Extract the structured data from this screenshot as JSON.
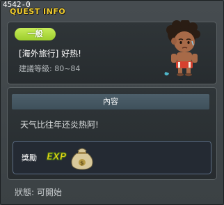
{
  "window": {
    "quest_id": "4542-0",
    "title": "QUEST INFO"
  },
  "quest": {
    "category": "一般",
    "name": "[海外旅行] 好热!",
    "level_range": "建議等級: 80~84"
  },
  "content": {
    "header": "內容",
    "description": "天气比往年还炎热阿!"
  },
  "reward": {
    "label": "獎勵",
    "exp_text": "EXP",
    "icons": [
      "exp-icon",
      "meso-bag-icon"
    ]
  },
  "status": {
    "text": "狀態: 可開始"
  },
  "colors": {
    "title": "#f2ce2e",
    "badge": "#a9d83a",
    "panel": "#2b3134",
    "header": "#455764",
    "reward_border": "#5d6f85"
  }
}
